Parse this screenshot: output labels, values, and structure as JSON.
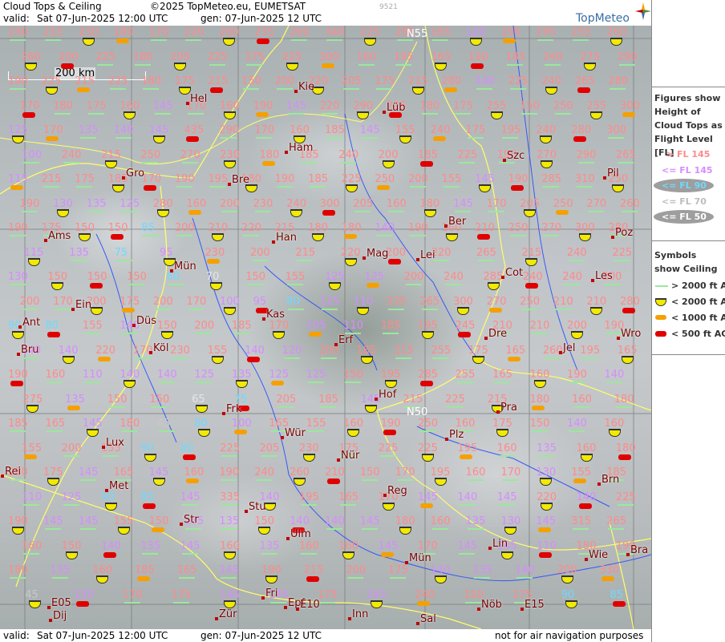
{
  "header": {
    "title": "Cloud Tops & Ceiling",
    "copyright": "©2025 TopMeteo.eu, EUMETSAT",
    "valid_label": "valid:",
    "valid_value": "Sat  07-Jun-2025  12:00 UTC",
    "gen_value": "gen: 07-Jun-2025 12 UTC",
    "image_id": "9521",
    "logo": "TopMeteo"
  },
  "footer": {
    "valid_label": "valid:",
    "valid_value": "Sat  07-Jun-2025  12:00 UTC",
    "gen_value": "gen: 07-Jun-2025 12 UTC",
    "disclaimer": "not for air navigation purposes"
  },
  "map": {
    "scale_label": "200 km",
    "gridline_labels": [
      "N55",
      "N50"
    ],
    "cities": [
      "Kie",
      "Hel",
      "Lüb",
      "Ham",
      "Szc",
      "Gro",
      "Bre",
      "Pil",
      "Ber",
      "Ams",
      "Han",
      "Poz",
      "Mag",
      "Lei",
      "Mün",
      "Cot",
      "Les",
      "Ein",
      "Kas",
      "Ant",
      "Düs",
      "Dre",
      "Wro",
      "Erf",
      "Bru",
      "Köl",
      "Jel",
      "Hof",
      "Pra",
      "Frk",
      "Lux",
      "Wür",
      "Plz",
      "Rei",
      "Nür",
      "Met",
      "Reg",
      "Brn",
      "Stu",
      "Str",
      "Ulm",
      "Lin",
      "Mün",
      "Wie",
      "Bra",
      "Fri",
      "Epf",
      "Inn",
      "Zür",
      "Dij",
      "Sal",
      "Nöb",
      "E15",
      "E05",
      "E10"
    ],
    "colors": {
      "fl_gt_145": "#ff8a8a",
      "fl_le_145": "#d68cff",
      "fl_le_90": "#6fd9ff",
      "fl_le_70": "#e6e6e6",
      "fl_le_50": "#c8c8c8",
      "ceil_gt_2000": "#9be89b",
      "ceil_lt_2000": "#f2ea00",
      "ceil_lt_1000": "#f5a000",
      "ceil_lt_500": "#e00000"
    }
  },
  "legend": {
    "heights_title": "Figures show Height of Cloud Tops as Flight Level  [FL]",
    "heights": [
      {
        "label": "> FL 145",
        "color": "#ff8a8a"
      },
      {
        "label": "<= FL 145",
        "color": "#d68cff"
      },
      {
        "label": "<= FL 90",
        "color": "#6fd9ff"
      },
      {
        "label": "<= FL 70",
        "color": "#bdbdbd"
      },
      {
        "label": "<= FL 50",
        "color": "#ffffff"
      }
    ],
    "symbols_title": "Symbols show Ceiling",
    "symbols": [
      {
        "label": "> 2000 ft AGL",
        "icon": "green-line-icon"
      },
      {
        "label": "< 2000 ft AGL",
        "icon": "yellow-half-circle-icon"
      },
      {
        "label": "< 1000 ft AGL",
        "icon": "orange-bar-icon"
      },
      {
        "label": "< 500 ft AGL",
        "icon": "red-bar-icon"
      }
    ]
  },
  "values": {
    "row1": [
      "230",
      "215",
      "230",
      "180",
      "170",
      "220",
      "260",
      "235",
      "260",
      "340",
      "225",
      "285",
      "165",
      "120",
      "195",
      "195",
      "255",
      "260"
    ],
    "row2": [
      "260",
      "200",
      "225",
      "180",
      "205",
      "225",
      "175",
      "225",
      "300",
      "160",
      "195",
      "165",
      "190",
      "185",
      "240",
      "275",
      "290"
    ],
    "row3": [
      "190",
      "225",
      "215",
      "225",
      "180",
      "175",
      "215",
      "150",
      "200",
      "220",
      "205",
      "175",
      "215",
      "280",
      "140",
      "225",
      "240",
      "265",
      "280"
    ],
    "row4": [
      "170",
      "180",
      "175",
      "160",
      "145",
      "170",
      "160",
      "190",
      "145",
      "220",
      "290",
      "225",
      "180",
      "175",
      "255",
      "150",
      "250",
      "255",
      "300"
    ],
    "row5": [
      "125",
      "170",
      "135",
      "140",
      "145",
      "435",
      "290",
      "170",
      "160",
      "185",
      "145",
      "155",
      "240",
      "175",
      "195",
      "240",
      "280",
      "300"
    ],
    "row6": [
      "100",
      "240",
      "215",
      "250",
      "270",
      "230",
      "180",
      "185",
      "240",
      "200",
      "185",
      "225",
      "190",
      "270",
      "290",
      "265"
    ],
    "row7": [
      "115",
      "215",
      "175",
      "185",
      "170",
      "190",
      "195",
      "180",
      "190",
      "185",
      "225",
      "250",
      "200",
      "155",
      "145",
      "190",
      "285",
      "310",
      "250"
    ],
    "row8": [
      "190",
      "130",
      "135",
      "125",
      "280",
      "160",
      "200",
      "230",
      "240",
      "300",
      "205",
      "160",
      "180",
      "145",
      "170",
      "205",
      "250",
      "270",
      "260"
    ],
    "row9": [
      "190",
      "175",
      "150",
      "150",
      "85",
      "200",
      "210",
      "220",
      "215",
      "180",
      "180",
      "140",
      "190",
      "160",
      "210",
      "250",
      "270",
      "300",
      "280"
    ],
    "row10": [
      "115",
      "135",
      "75",
      "95",
      "230",
      "200",
      "215",
      "220",
      "200",
      "220",
      "265",
      "215",
      "240",
      "225"
    ],
    "row11": [
      "130",
      "150",
      "150",
      "150",
      "80",
      "70",
      "150",
      "155",
      "125",
      "125",
      "200",
      "240",
      "285",
      "240",
      "240",
      "200"
    ],
    "row12": [
      "200",
      "170",
      "200",
      "175",
      "200",
      "170",
      "100",
      "95",
      "80",
      "115",
      "110",
      "235",
      "265",
      "300",
      "270",
      "250",
      "210",
      "210",
      "280"
    ],
    "row13": [
      "90",
      "80",
      "155",
      "140",
      "150",
      "200",
      "185",
      "170",
      "105",
      "110",
      "185",
      "195",
      "245",
      "210",
      "210",
      "200",
      "190"
    ],
    "row14": [
      "140",
      "140",
      "220",
      "170",
      "230",
      "155",
      "140",
      "120",
      "200",
      "185",
      "215",
      "255",
      "175",
      "165",
      "260",
      "195",
      "165"
    ],
    "row15": [
      "190",
      "160",
      "110",
      "140",
      "140",
      "125",
      "135",
      "125",
      "125",
      "150",
      "195",
      "285",
      "255",
      "165",
      "160",
      "190",
      "140"
    ],
    "row16": [
      "275",
      "135",
      "150",
      "150",
      "65",
      "75",
      "205",
      "185",
      "145",
      "215",
      "225",
      "215",
      "180",
      "160",
      "180"
    ],
    "row17": [
      "185",
      "165",
      "145",
      "180",
      "45",
      "80",
      "100",
      "165",
      "155",
      "160",
      "190",
      "250",
      "160",
      "175",
      "150",
      "140",
      "160"
    ],
    "row18": [
      "155",
      "200",
      "155",
      "90",
      "80",
      "225",
      "205",
      "230",
      "175",
      "225",
      "225",
      "195",
      "160",
      "135",
      "160",
      "180"
    ],
    "row19": [
      "280",
      "175",
      "145",
      "165",
      "145",
      "160",
      "190",
      "240",
      "260",
      "210",
      "150",
      "170",
      "195",
      "160",
      "170",
      "130",
      "155",
      "185"
    ],
    "row20": [
      "110",
      "125",
      "90",
      "85",
      "145",
      "335",
      "140",
      "195",
      "165",
      "170",
      "145",
      "140",
      "145",
      "220",
      "140",
      "225"
    ],
    "row21": [
      "190",
      "145",
      "145",
      "155",
      "150",
      "135",
      "135",
      "150",
      "140",
      "140",
      "145",
      "180",
      "160",
      "135",
      "130",
      "145",
      "315",
      "265"
    ],
    "row22": [
      "160",
      "150",
      "140",
      "135",
      "145",
      "160",
      "135",
      "160",
      "160",
      "145",
      "170",
      "145",
      "145",
      "110",
      "180",
      "190"
    ],
    "row23": [
      "180",
      "135",
      "160",
      "185",
      "165",
      "145",
      "190",
      "215",
      "200",
      "175",
      "140",
      "135",
      "140",
      "200",
      "330"
    ],
    "row24": [
      "45",
      "130",
      "170",
      "175",
      "145",
      "145",
      "175",
      "145",
      "240",
      "150",
      "175",
      "90",
      "85"
    ]
  }
}
